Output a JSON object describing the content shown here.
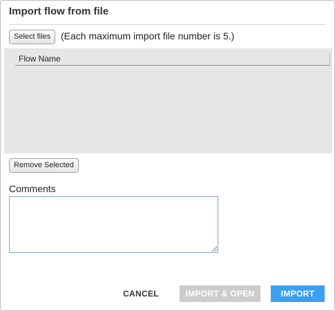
{
  "dialog": {
    "title": "Import flow from file",
    "select_files_label": "Select files",
    "hint": "(Each maximum import file number is 5.)",
    "file_table": {
      "columns": [
        "Flow Name"
      ],
      "rows": []
    },
    "remove_selected_label": "Remove Selected",
    "comments_label": "Comments",
    "comments_value": ""
  },
  "footer": {
    "cancel_label": "CANCEL",
    "import_open_label": "IMPORT & OPEN",
    "import_label": "IMPORT",
    "import_open_enabled": false
  },
  "colors": {
    "primary": "#3ba0ee",
    "disabled": "#cccccc",
    "file_area_bg": "#e6e6e6"
  }
}
